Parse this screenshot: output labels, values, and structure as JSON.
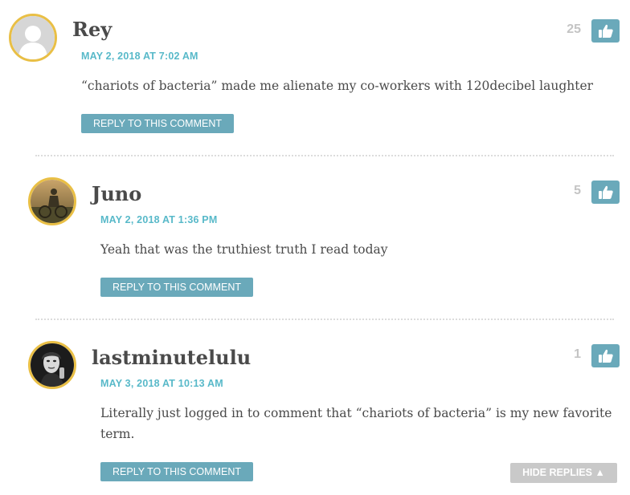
{
  "comments": [
    {
      "author": "Rey",
      "date": "MAY 2, 2018 AT 7:02 AM",
      "text": "“chariots of bacteria” made me alienate my co-workers with 120decibel laughter",
      "likes": "25",
      "reply_label": "REPLY TO THIS COMMENT",
      "avatar_icon": "default-user-avatar"
    },
    {
      "author": "Juno",
      "date": "MAY 2, 2018 AT 1:36 PM",
      "text": "Yeah that was the truthiest truth I read today",
      "likes": "5",
      "reply_label": "REPLY TO THIS COMMENT",
      "avatar_icon": "photo-avatar"
    },
    {
      "author": "lastminutelulu",
      "date": "MAY 3, 2018 AT 10:13 AM",
      "text": "Literally just logged in to comment that “chariots of bacteria” is my new favorite term.",
      "likes": "1",
      "reply_label": "REPLY TO THIS COMMENT",
      "avatar_icon": "photo-avatar"
    }
  ],
  "hide_replies_label": "HIDE REPLIES ▲",
  "like_icon": "thumbs-up-icon",
  "colors": {
    "accent": "#6aa9ba",
    "date": "#58b9c9",
    "avatar_border": "#e9bf45",
    "count": "#c4c4c4",
    "hide_button": "#c9c9c9"
  }
}
